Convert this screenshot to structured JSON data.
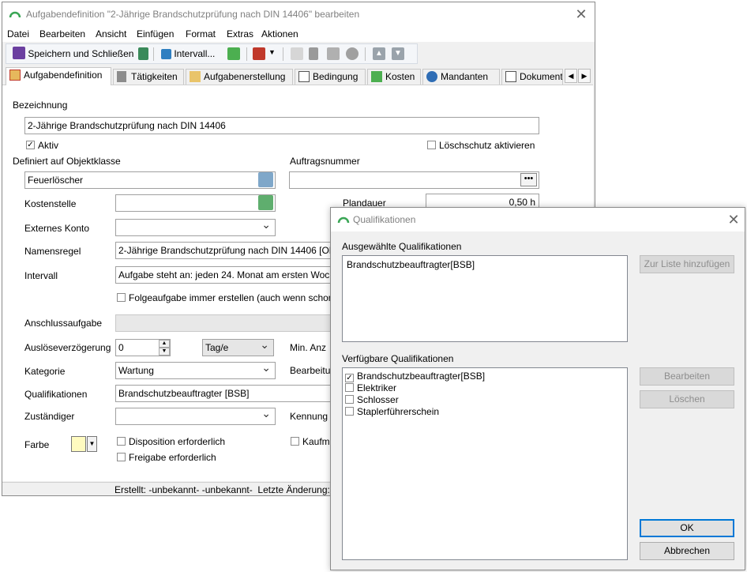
{
  "main_window": {
    "title": "Aufgabendefinition \"2-Jährige Brandschutzprüfung nach DIN 14406\" bearbeiten",
    "menu": [
      "Datei",
      "Bearbeiten",
      "Ansicht",
      "Einfügen",
      "Format",
      "Extras",
      "Aktionen"
    ],
    "toolbar": {
      "save_close_label": "Speichern und Schließen",
      "interval_label": "Intervall..."
    },
    "tabs": [
      "Aufgabendefinition",
      "Tätigkeiten",
      "Aufgabenerstellung",
      "Bedingung",
      "Kosten",
      "Mandanten",
      "Dokument"
    ],
    "form": {
      "bezeichnung_label": "Bezeichnung",
      "bezeichnung_value": "2-Jährige Brandschutzprüfung nach DIN 14406",
      "aktiv_label": "Aktiv",
      "aktiv_checked": true,
      "loeschschutz_label": "Löschschutz aktivieren",
      "loeschschutz_checked": false,
      "objektklasse_label": "Definiert auf Objektklasse",
      "objektklasse_value": "Feuerlöscher",
      "auftragsnummer_label": "Auftragsnummer",
      "auftragsnummer_value": "",
      "kostenstelle_label": "Kostenstelle",
      "kostenstelle_value": "",
      "plandauer_label": "Plandauer",
      "plandauer_value": "0,50 h",
      "externes_konto_label": "Externes Konto",
      "externes_konto_value": "",
      "namensregel_label": "Namensregel",
      "namensregel_value": "2-Jährige Brandschutzprüfung nach DIN 14406 [Obj",
      "intervall_label": "Intervall",
      "intervall_value": "Aufgabe steht an: jeden 24. Monat am ersten Woch",
      "folgeaufgabe_label": "Folgeaufgabe immer erstellen (auch wenn schon",
      "anschlussaufgabe_label": "Anschlussaufgabe",
      "ausloese_label": "Auslöseverzögerung",
      "ausloese_value": "0",
      "ausloese_unit": "Tag/e",
      "min_anz_label": "Min. Anz",
      "kategorie_label": "Kategorie",
      "kategorie_value": "Wartung",
      "bearbeitung_label": "Bearbeitu",
      "qualifikationen_label": "Qualifikationen",
      "qualifikationen_value": "Brandschutzbeauftragter [BSB]",
      "zustaendiger_label": "Zuständiger",
      "zustaendiger_value": "",
      "kennung_label": "Kennung",
      "farbe_label": "Farbe",
      "farbe_color": "#fffbc0",
      "disposition_label": "Disposition erforderlich",
      "freigabe_label": "Freigabe erforderlich",
      "kaufm_label": "Kaufm"
    },
    "status": "Erstellt: -unbekannt- -unbekannt-  Letzte Änderung:"
  },
  "dialog": {
    "title": "Qualifikationen",
    "selected_label": "Ausgewählte Qualifikationen",
    "selected_items": [
      "Brandschutzbeauftragter[BSB]"
    ],
    "add_button": "Zur Liste hinzufügen",
    "available_label": "Verfügbare Qualifikationen",
    "available_items": [
      {
        "label": "Brandschutzbeauftragter[BSB]",
        "checked": true
      },
      {
        "label": "Elektriker",
        "checked": false
      },
      {
        "label": "Schlosser",
        "checked": false
      },
      {
        "label": "Staplerführerschein",
        "checked": false
      }
    ],
    "edit_button": "Bearbeiten",
    "delete_button": "Löschen",
    "ok_button": "OK",
    "cancel_button": "Abbrechen"
  }
}
